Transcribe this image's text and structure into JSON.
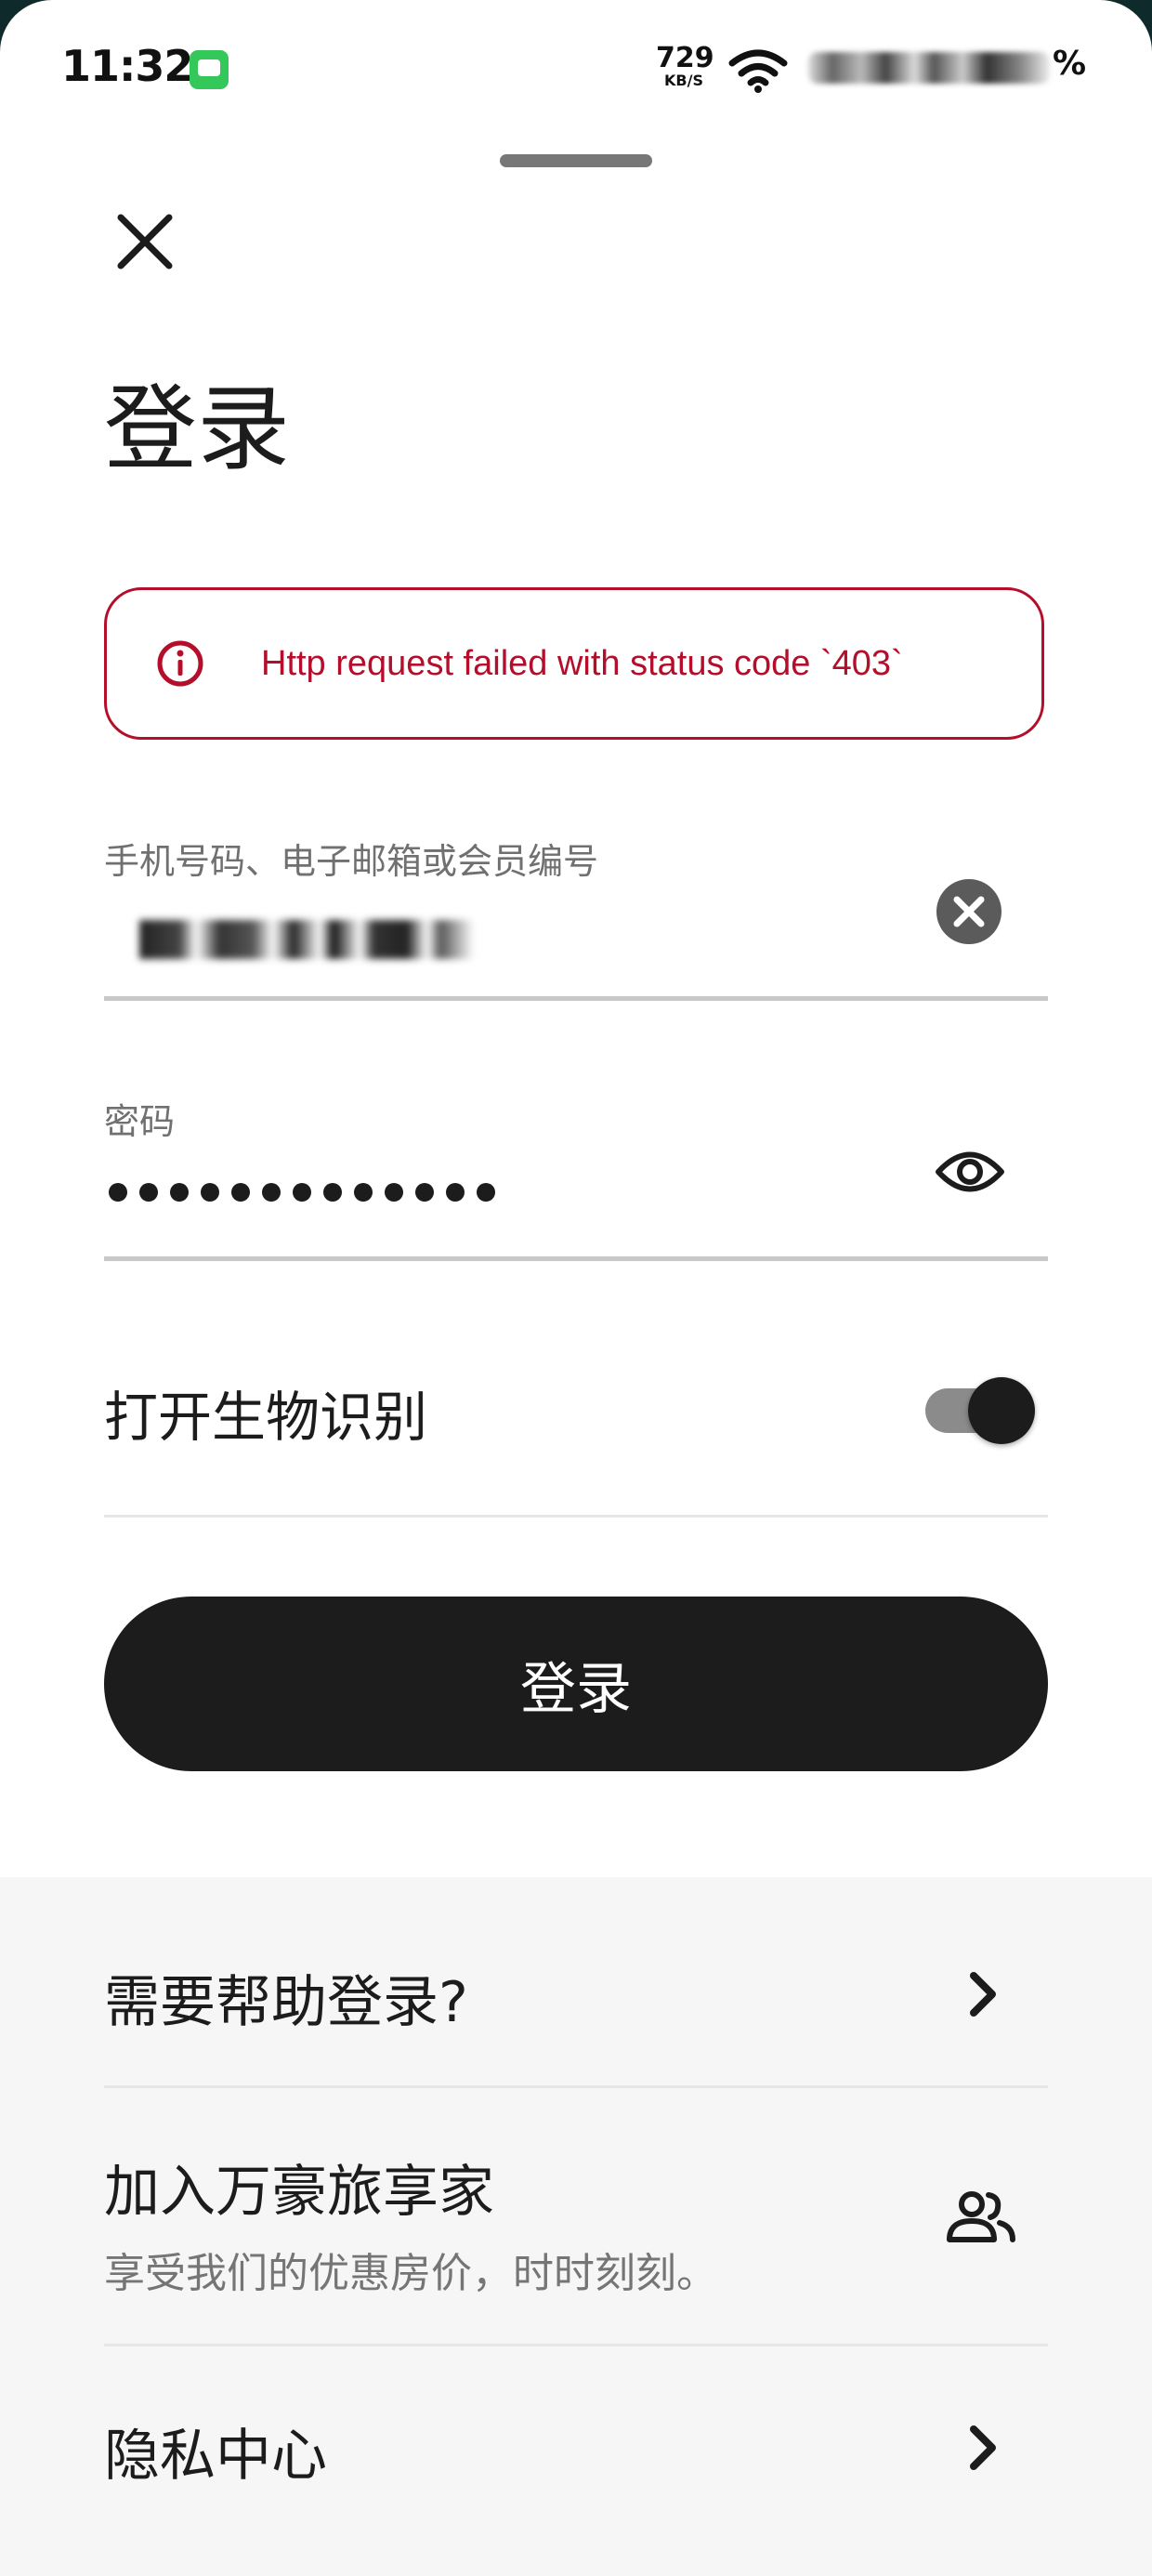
{
  "status_bar": {
    "time": "11:32",
    "net_speed": "729",
    "net_speed_unit": "KB/S",
    "battery_suffix": "%"
  },
  "header": {
    "title": "登录"
  },
  "error": {
    "message": "Http request failed with status code `403`",
    "color": "#b40e2b"
  },
  "form": {
    "username_label": "手机号码、电子邮箱或会员编号",
    "password_label": "密码",
    "password_mask": "●●●●●●●●●●●●●",
    "biometric_label": "打开生物识别",
    "biometric_enabled": true,
    "submit_label": "登录"
  },
  "links": {
    "help_title": "需要帮助登录?",
    "join_title": "加入万豪旅享家",
    "join_subtitle": "享受我们的优惠房价，时时刻刻。",
    "privacy_title": "隐私中心"
  },
  "icons": {
    "close": "close-icon",
    "error": "info-icon",
    "clear": "clear-icon",
    "visibility": "eye-icon",
    "chevron": "chevron-right-icon",
    "members": "people-icon"
  }
}
